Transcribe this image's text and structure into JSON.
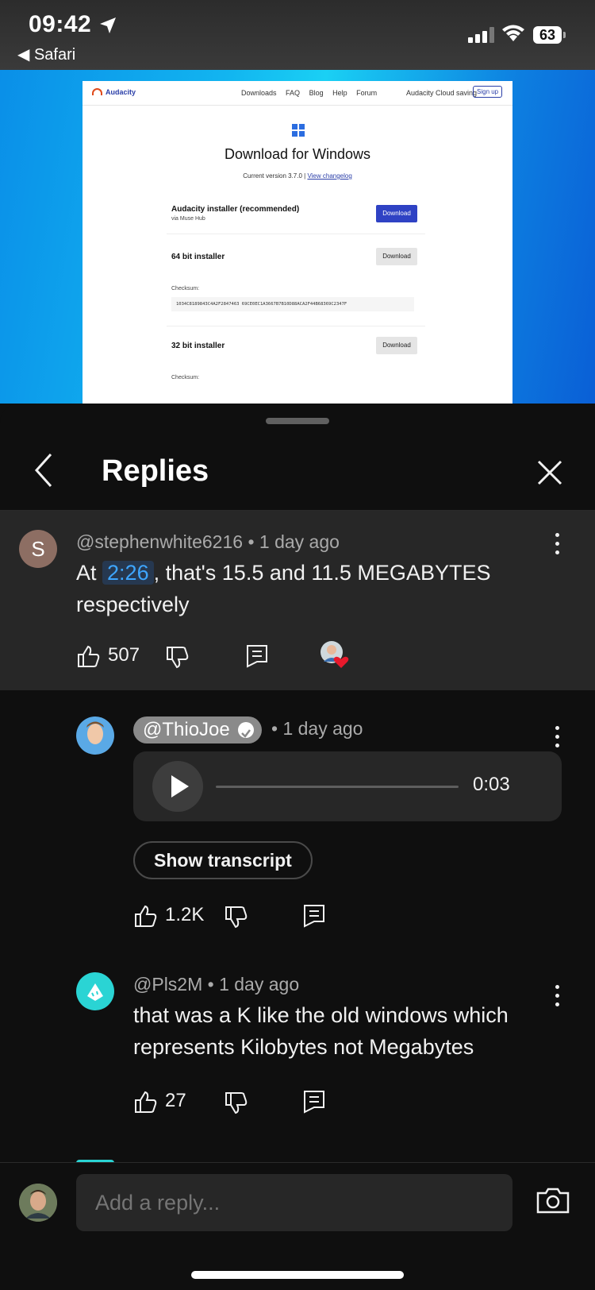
{
  "status_bar": {
    "time": "09:42",
    "back_app": "◀ Safari",
    "battery": "63"
  },
  "video": {
    "site": {
      "brand": "Audacity",
      "nav": [
        "Downloads",
        "FAQ",
        "Blog",
        "Help",
        "Forum"
      ],
      "cloud": "Audacity Cloud saving",
      "signup": "Sign up",
      "title": "Download for Windows",
      "version_text": "Current version 3.7.0 |",
      "changelog": "View changelog",
      "installer_title": "Audacity installer (recommended)",
      "installer_sub": "via Muse Hub",
      "download_label": "Download",
      "bit64_title": "64 bit installer",
      "checksum_label": "Checksum:",
      "checksum_value": "1034C8189843C4A2F2847463 69CE0EC1A3667B7B10D88ACA2F44B68369C2347F",
      "bit32_title": "32 bit installer"
    }
  },
  "header": {
    "title": "Replies"
  },
  "parent_comment": {
    "avatar_letter": "S",
    "author": "@stephenwhite6216",
    "time": "• 1 day ago",
    "text_before": "At",
    "timestamp": "2:26",
    "text_after": ", that's 15.5 and 11.5 MEGABYTES respectively",
    "likes": "507"
  },
  "reply1": {
    "author": "@ThioJoe",
    "time": "• 1 day ago",
    "duration": "0:03",
    "transcript_label": "Show transcript",
    "likes": "1.2K"
  },
  "reply2": {
    "author": "@Pls2M",
    "time": "• 1 day ago",
    "text": "that was a K like the old windows which represents Kilobytes not Megabytes",
    "likes": "27"
  },
  "footer": {
    "placeholder": "Add a reply..."
  },
  "colors": {
    "accent": "#3ea6ff",
    "heart": "#e8192c",
    "bg": "#0f0f0f",
    "card": "#272727"
  }
}
